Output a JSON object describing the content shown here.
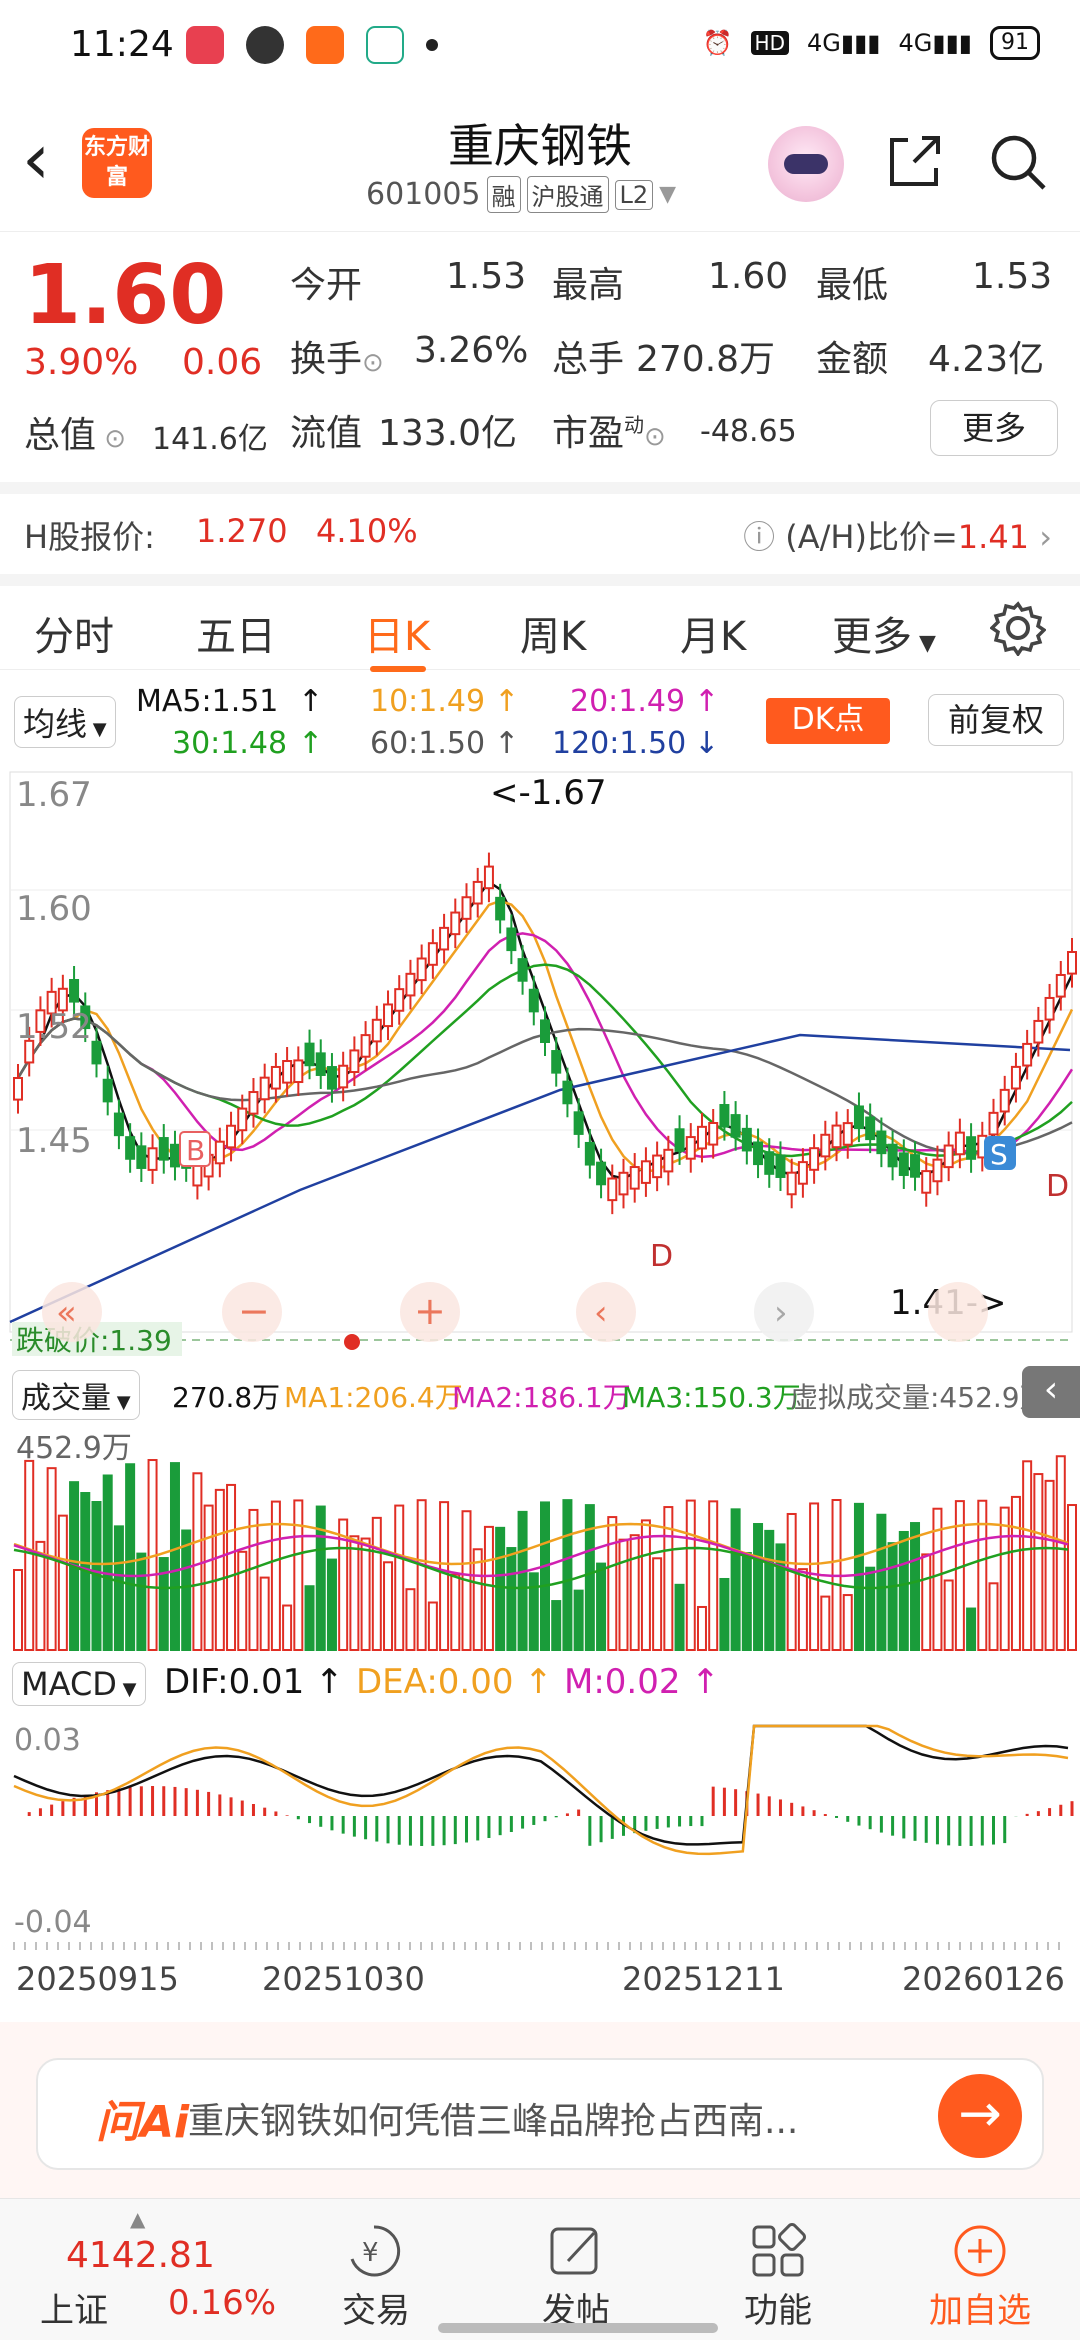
{
  "status_bar": {
    "time": "11:24",
    "battery": "91",
    "net1": "HD",
    "net2": "4G",
    "net3": "4G"
  },
  "header": {
    "logo_text": "东方财富",
    "stock_name": "重庆钢铁",
    "stock_code": "601005",
    "tags": [
      "融",
      "沪股通",
      "L2"
    ]
  },
  "quote": {
    "price": "1.60",
    "change_pct": "3.90%",
    "change": "0.06",
    "total_value_label": "总值",
    "total_value": "141.6亿",
    "cells": [
      {
        "label": "今开",
        "value": "1.53",
        "color": "green"
      },
      {
        "label": "最高",
        "value": "1.60",
        "color": "red"
      },
      {
        "label": "最低",
        "value": "1.53",
        "color": "green"
      },
      {
        "label": "换手",
        "value": "3.26%",
        "color": "black"
      },
      {
        "label": "总手",
        "value": "270.8万",
        "color": "black"
      },
      {
        "label": "金额",
        "value": "4.23亿",
        "color": "black"
      },
      {
        "label": "流值",
        "value": "133.0亿",
        "color": "black"
      },
      {
        "label": "市盈",
        "value": "-48.65",
        "color": "black"
      }
    ],
    "pe_superscript": "动",
    "more_button": "更多"
  },
  "h_share": {
    "label": "H股报价:",
    "price": "1.270",
    "pct": "4.10%",
    "ratio": "(A/H)比价=",
    "ratio_value": "1.41"
  },
  "tabs": [
    "分时",
    "五日",
    "日K",
    "周K",
    "月K",
    "更多"
  ],
  "active_tab": "日K",
  "ma_row": {
    "selector": "均线",
    "ma5": "MA5:1.51",
    "ma10": "10:1.49",
    "ma20": "20:1.49",
    "ma30": "30:1.48",
    "ma60": "60:1.50",
    "ma120": "120:1.50",
    "dk_button": "DK点",
    "adjust_button": "前复权"
  },
  "colors": {
    "up": "#e02e24",
    "down": "#1a9c3a",
    "ma5": "#111111",
    "ma10": "#f0a020",
    "ma20": "#d020b0",
    "ma30": "#20a020",
    "ma60": "#666666",
    "ma120": "#2040a0",
    "accent": "#ff5a1e"
  },
  "kchart": {
    "y_labels": [
      "1.67",
      "1.60",
      "1.52",
      "1.45"
    ],
    "high_label": "<-1.67",
    "low_label": "1.41->",
    "break_label": "跌破价:1.39",
    "markers": [
      "B",
      "S",
      "D",
      "D"
    ]
  },
  "volume": {
    "selector": "成交量",
    "current": "270.8万",
    "ma1": "MA1:206.4万",
    "ma2": "MA2:186.1万",
    "ma3": "MA3:150.3万",
    "virtual": "虚拟成交量:452.9万",
    "max_label": "452.9万"
  },
  "macd": {
    "selector": "MACD",
    "dif": "DIF:0.01",
    "dea": "DEA:0.00",
    "m": "M:0.02",
    "top_label": "0.03",
    "bottom_label": "-0.04"
  },
  "dates": [
    "20250915",
    "20251030",
    "20251211",
    "20260126"
  ],
  "ai_bar": {
    "logo": "问Ai",
    "prompt": "重庆钢铁如何凭借三峰品牌抢占西南..."
  },
  "bottom_nav": {
    "index_value": "4142.81",
    "index_name": "上证",
    "index_pct": "0.16%",
    "items": [
      "交易",
      "发帖",
      "功能",
      "加自选"
    ]
  }
}
